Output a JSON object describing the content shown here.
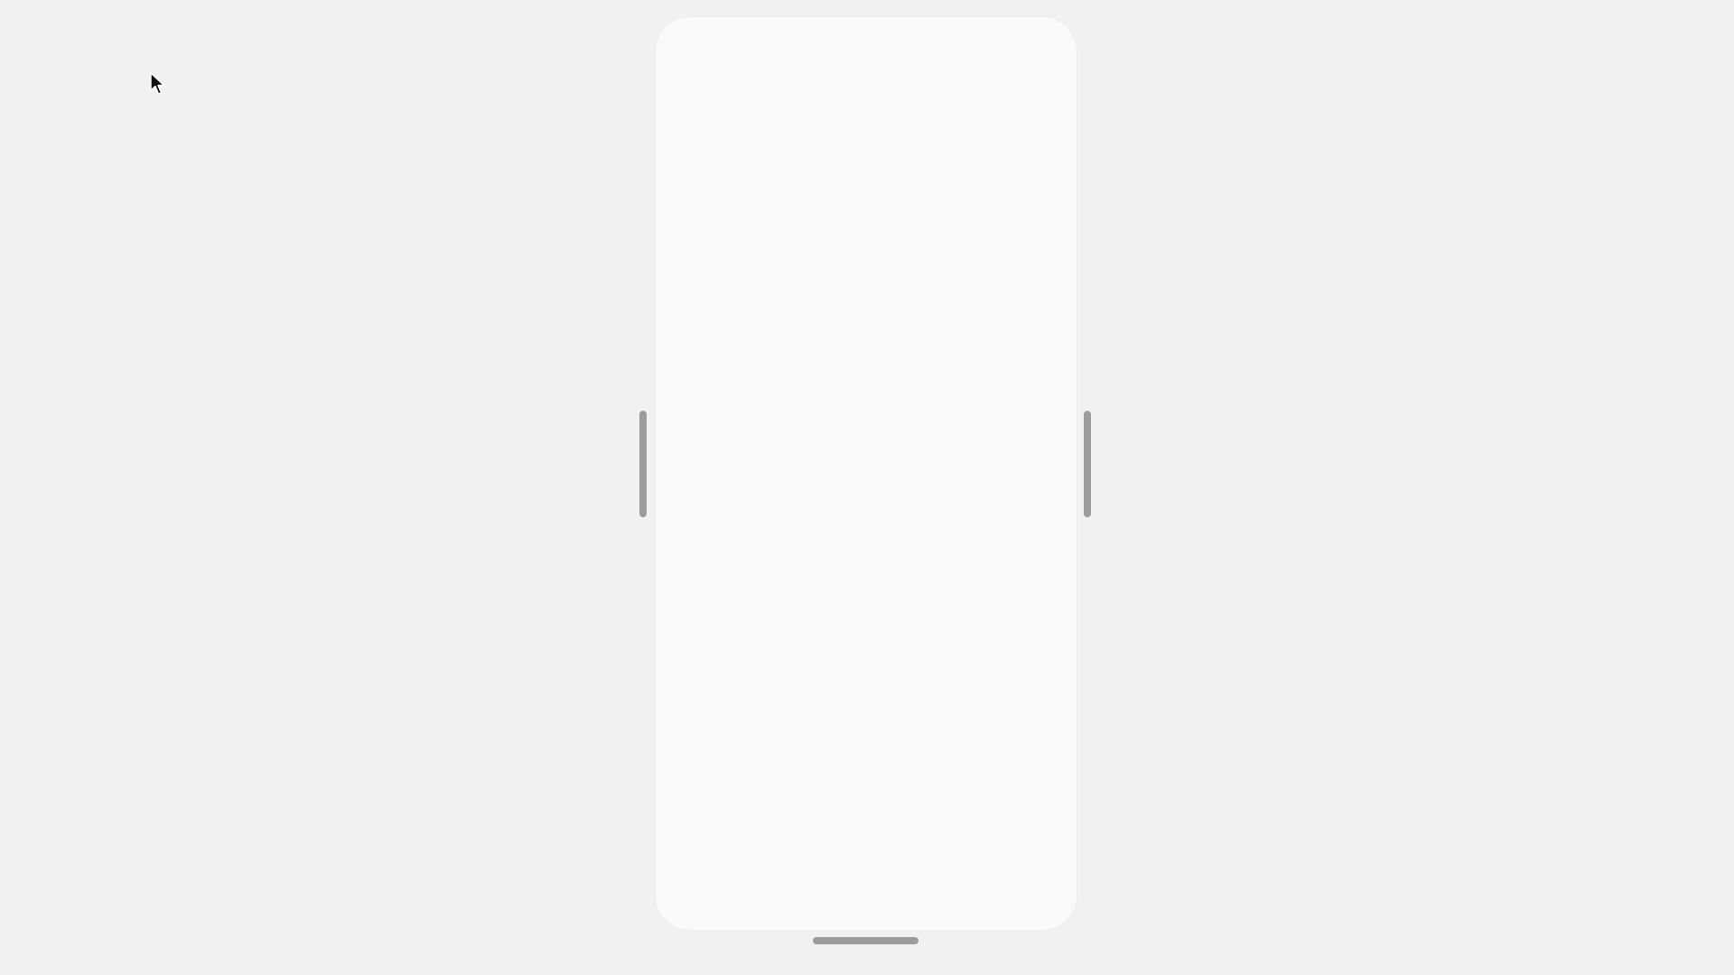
{
  "stage": {
    "background": "#f2f1f1"
  },
  "viewport": {
    "background": "#fafafa"
  },
  "handles": {
    "color": "#9c9c9c",
    "left_icon": "resize-handle-horizontal",
    "right_icon": "resize-handle-horizontal",
    "bottom_icon": "resize-handle-vertical"
  },
  "cursor": {
    "icon": "mouse-pointer-arrow"
  }
}
